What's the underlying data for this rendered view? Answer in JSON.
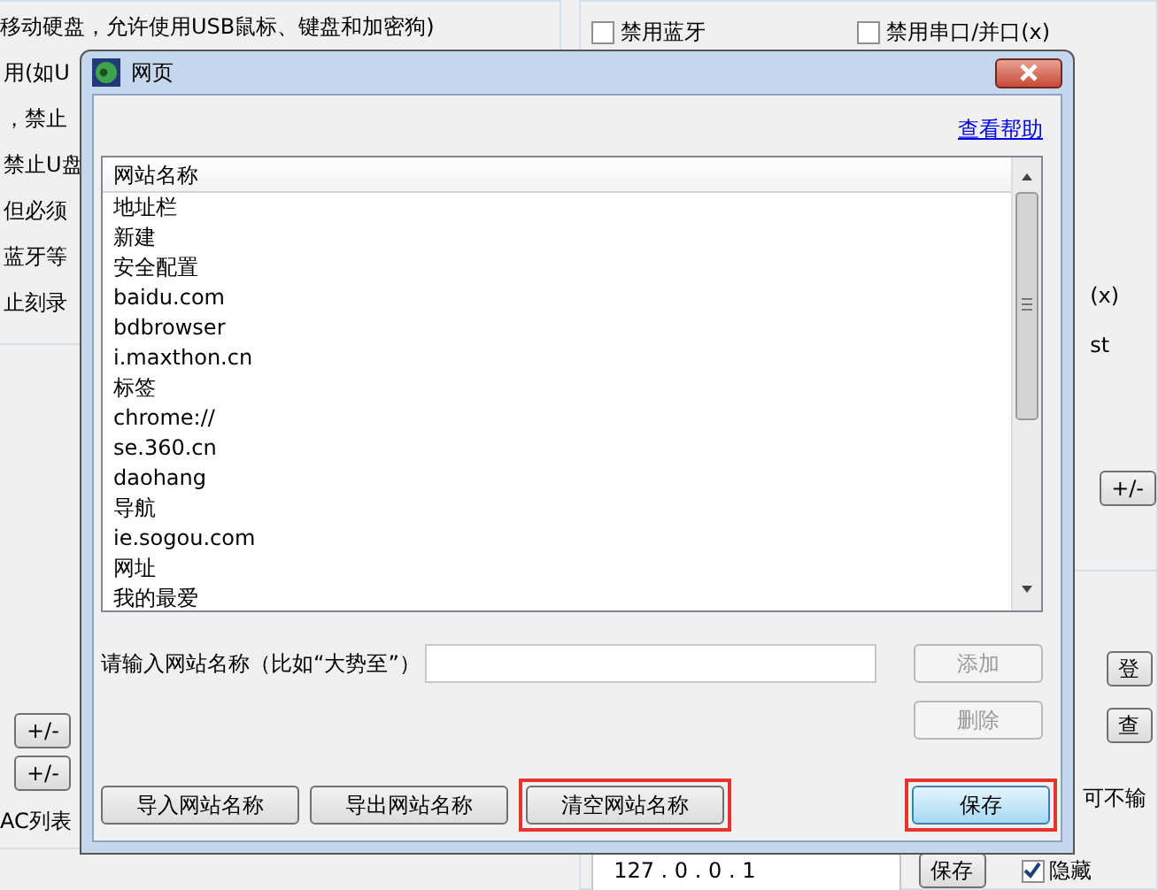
{
  "background": {
    "left_panel": {
      "lines": [
        "移动硬盘，允许使用USB鼠标、键盘和加密狗)",
        "用(如U",
        "，禁止",
        "禁止U盘",
        "但必须",
        "蓝牙等",
        "止刻录"
      ],
      "buttons": [
        "+/-",
        "+/-"
      ],
      "label": "AC列表"
    },
    "right_panel": {
      "checkboxes": [
        {
          "label": "禁用蓝牙",
          "checked": false
        },
        {
          "label": "禁用串口/并口(x)",
          "checked": false
        }
      ],
      "text_1": "(x)",
      "text_2": "st",
      "button_1": "+/-",
      "button_2": "登",
      "button_3": "查",
      "text_3": "可不输",
      "ip_field": {
        "value": "127 . 0 . 0 . 1"
      },
      "save_button": "保存",
      "checkbox": {
        "label": "隐藏",
        "checked": true
      }
    }
  },
  "dialog": {
    "title": "网页",
    "help_link": "查看帮助",
    "list": {
      "column": "网站名称",
      "rows": [
        "地址栏",
        "新建",
        "安全配置",
        "baidu.com",
        "bdbrowser",
        "i.maxthon.cn",
        "标签",
        "chrome://",
        "se.360.cn",
        "daohang",
        "导航",
        "ie.sogou.com",
        "网址",
        "我的最爱"
      ]
    },
    "input_label": "请输入网站名称（比如“大势至”）",
    "add_button": {
      "label": "添加",
      "disabled": true
    },
    "delete_button": {
      "label": "删除",
      "disabled": true
    },
    "footer_buttons": [
      {
        "label": "导入网站名称",
        "highlighted": false
      },
      {
        "label": "导出网站名称",
        "highlighted": false
      },
      {
        "label": "清空网站名称",
        "highlighted": true
      }
    ],
    "save_button": {
      "label": "保存",
      "highlighted": true
    }
  }
}
